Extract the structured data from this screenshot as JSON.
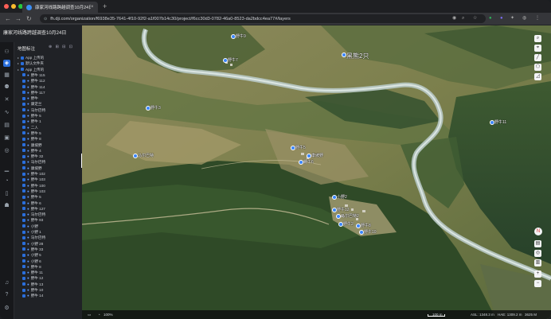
{
  "browser": {
    "tab_title": "康家河线路跨越调查10月24日",
    "tab_close": "×",
    "new_tab": "+",
    "url": "fh.dji.com/organization/f6938e35-7641-4f10-92f2-a1f007b14c30/project/f6cc30d3-0782-46a0-8523-da2bdcc4ea77#/layers",
    "back": "←",
    "forward": "→",
    "reload": "↻"
  },
  "project": {
    "title": "康家河线路跨越调查10月24日"
  },
  "panel": {
    "header": "地图标注",
    "tools": "⊕ ⊞ ⊟ ⊡",
    "groups": [
      {
        "label": "App 上传的"
      },
      {
        "label": "默认文件夹"
      },
      {
        "label": "App 上传的"
      }
    ],
    "items": [
      "野牛 115",
      "野牛 112",
      "野牛 114",
      "野牛 117",
      "野牛",
      "康定兰",
      "马尔巴特",
      "野牛 5",
      "野牛 1",
      "二人",
      "野牛 5",
      "野牛 8",
      "康坡野",
      "野牛 4",
      "野牛 32",
      "马尔巴特",
      "康坡野",
      "野牛 102",
      "野牛 103",
      "野牛 100",
      "野牛 103",
      "野牛 5",
      "野牛 6",
      "野牛 127",
      "马尔巴特",
      "野牛 93",
      "小野",
      "小野 1",
      "马尔巴特",
      "小野 28",
      "野牛 33",
      "小野 5",
      "小野 6",
      "野牛 8",
      "野牛 11",
      "野牛 12",
      "野牛 13",
      "野牛 10",
      "野牛 14"
    ]
  },
  "map": {
    "labels": [
      {
        "text": "黑熊2只",
        "big": true
      },
      {
        "text": "野牛9"
      },
      {
        "text": "野牛7"
      },
      {
        "text": "野牛11"
      },
      {
        "text": "野牛3"
      },
      {
        "text": "马尔巴特"
      },
      {
        "text": "野牛5"
      },
      {
        "text": "康坡野"
      },
      {
        "text": "野牛6"
      },
      {
        "text": "小野2"
      },
      {
        "text": "马尔巴特2"
      },
      {
        "text": "野牛12"
      },
      {
        "text": "野牛2"
      },
      {
        "text": "野牛8"
      },
      {
        "text": "野牛10"
      }
    ]
  },
  "statusbar": {
    "zoom": "100%",
    "scale": "100 m",
    "alt1": "ASL: 1348.3 m",
    "alt2": "HAE: 1309.2 m",
    "mem": "3625 M"
  },
  "colors": {
    "accent": "#2a6edb",
    "forest_dark": "#2f4a27",
    "forest_mid": "#4d6a38",
    "slope_light": "#9a8f63",
    "river": "#b9c8c4"
  }
}
